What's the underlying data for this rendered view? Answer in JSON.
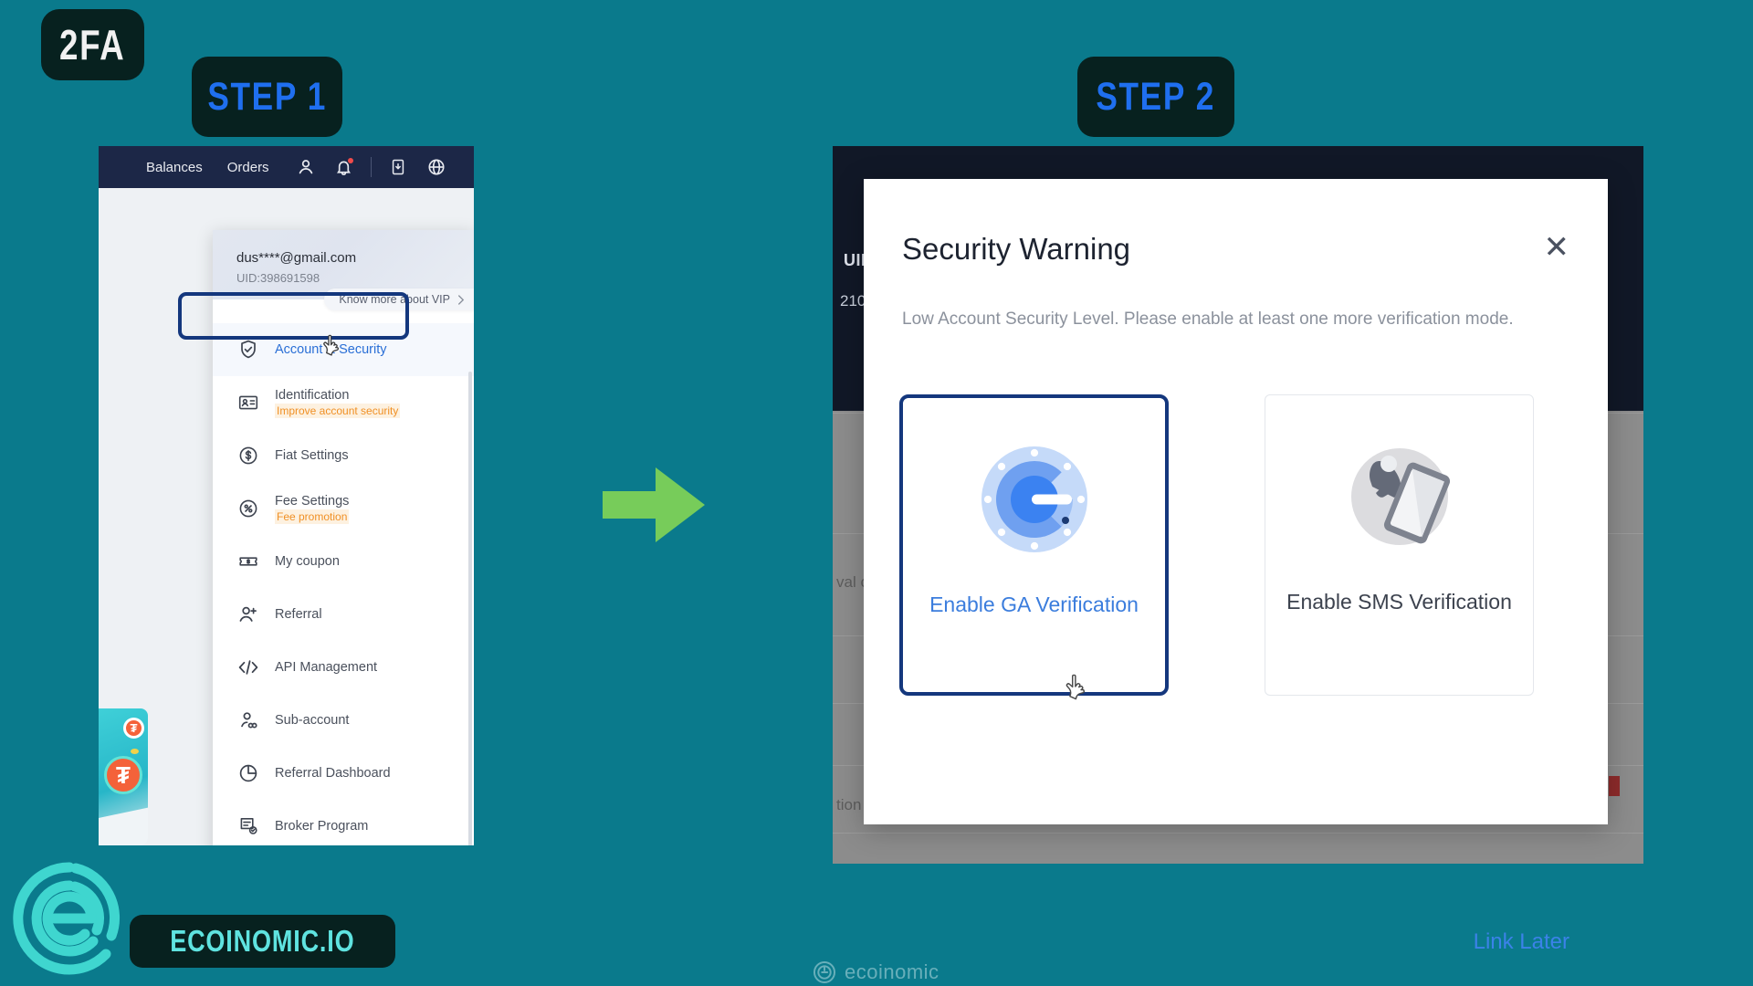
{
  "badges": {
    "feature": "2FA",
    "step1": "STEP 1",
    "step2": "STEP 2"
  },
  "colors": {
    "background": "#0a7a8c",
    "badge_bg": "#07211f",
    "step_text": "#1f6fef",
    "highlight_border": "#14377d",
    "arrow": "#77cc5a",
    "brand_teal": "#3fd6cf",
    "link_blue": "#3b82e8",
    "warning_orange": "#f09025"
  },
  "step1": {
    "topbar": {
      "links": [
        "Balances",
        "Orders"
      ],
      "icons": [
        "user-icon",
        "bell-icon",
        "download-app-icon",
        "globe-icon"
      ]
    },
    "dropdown": {
      "email": "dus****@gmail.com",
      "uid": "UID:398691598",
      "vip_label": "Know more about VIP",
      "vip_chevron": "chevron-right-icon",
      "items": [
        {
          "label": "Account & Security",
          "icon": "shield-check-icon",
          "sub": "",
          "active": true
        },
        {
          "label": "Identification",
          "icon": "id-card-icon",
          "sub": "Improve account security",
          "active": false
        },
        {
          "label": "Fiat Settings",
          "icon": "dollar-circle-icon",
          "sub": "",
          "active": false
        },
        {
          "label": "Fee Settings",
          "icon": "percent-circle-icon",
          "sub": "Fee promotion",
          "active": false
        },
        {
          "label": "My coupon",
          "icon": "coupon-icon",
          "sub": "",
          "active": false
        },
        {
          "label": "Referral",
          "icon": "user-plus-icon",
          "sub": "",
          "active": false
        },
        {
          "label": "API Management",
          "icon": "code-icon",
          "sub": "",
          "active": false
        },
        {
          "label": "Sub-account",
          "icon": "sub-account-icon",
          "sub": "",
          "active": false
        },
        {
          "label": "Referral Dashboard",
          "icon": "pie-chart-icon",
          "sub": "",
          "active": false
        },
        {
          "label": "Broker Program",
          "icon": "document-check-icon",
          "sub": "",
          "active": false
        }
      ]
    }
  },
  "arrow": {
    "icon": "arrow-right-icon"
  },
  "step2": {
    "background": {
      "uid_label": "UID",
      "uid_value": "210",
      "text_left": "val c",
      "text_bottom": "tion"
    },
    "modal": {
      "title": "Security Warning",
      "close_icon": "close-icon",
      "subtitle": "Low Account Security Level. Please enable at least one more verification mode.",
      "options": [
        {
          "label": "Enable GA Verification",
          "icon": "google-authenticator-icon",
          "selected": true
        },
        {
          "label": "Enable SMS Verification",
          "icon": "sms-phone-bell-icon",
          "selected": false
        }
      ],
      "link_later": "Link Later"
    }
  },
  "footer": {
    "logo_icon": "ecoinomic-logo-icon",
    "brand": "ECOINOMIC.IO",
    "watermark": "ecoinomic",
    "watermark_icon": "ecoinomic-mark-icon"
  }
}
